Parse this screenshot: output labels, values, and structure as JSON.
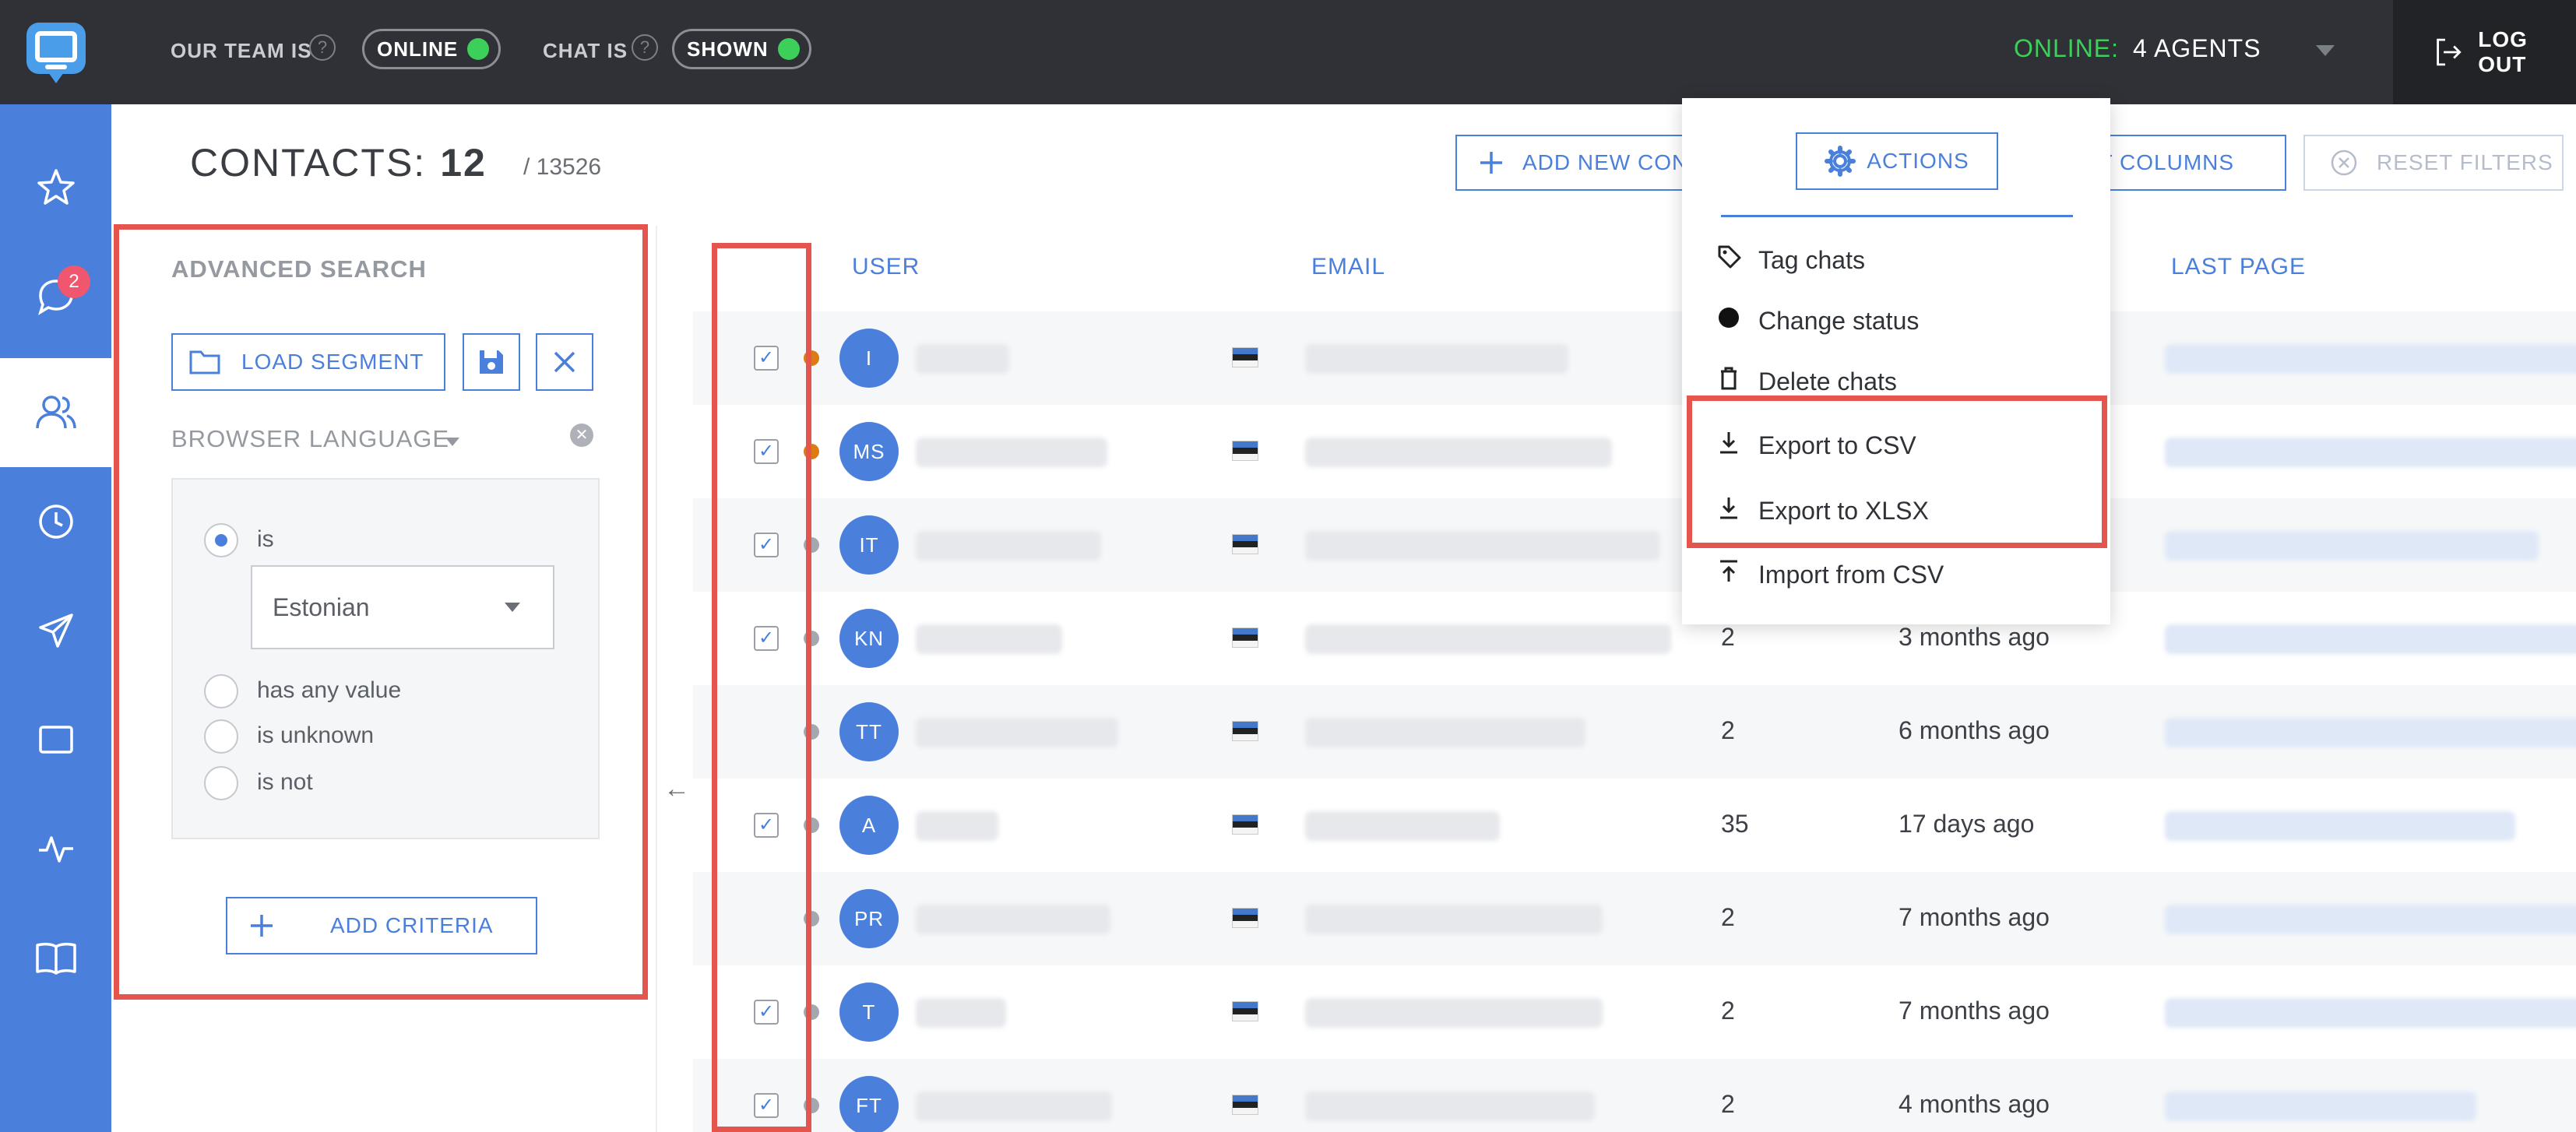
{
  "topbar": {
    "team_label": "OUR TEAM IS",
    "team_status": "ONLINE",
    "chat_label": "CHAT IS",
    "chat_status": "SHOWN",
    "online_key": "ONLINE:",
    "online_value": "4 AGENTS",
    "logout_label": "LOG OUT"
  },
  "nav": {
    "chat_badge": "2",
    "items": [
      "star-icon",
      "chat-icon",
      "users-icon",
      "clock-icon",
      "send-icon",
      "window-icon",
      "pulse-icon",
      "book-icon"
    ]
  },
  "header": {
    "title": "CONTACTS:",
    "count": "12",
    "total": "/ 13526",
    "add_new_label": "ADD NEW CONTACT",
    "edit_columns_label": "EDIT COLUMNS",
    "reset_filters_label": "RESET FILTERS"
  },
  "advanced_search": {
    "title": "ADVANCED SEARCH",
    "load_segment_label": "LOAD SEGMENT",
    "filter_label": "BROWSER LANGUAGE",
    "options": [
      "is",
      "has any value",
      "is unknown",
      "is not"
    ],
    "selected_option": "is",
    "selected_value": "Estonian",
    "add_criteria_label": "ADD CRITERIA"
  },
  "table": {
    "columns": [
      "USER",
      "EMAIL",
      "LAST PAGE"
    ],
    "rows": [
      {
        "initials": "I",
        "checked": true,
        "status": "orange",
        "chats": "",
        "last_seen": ""
      },
      {
        "initials": "MS",
        "checked": true,
        "status": "orange",
        "chats": "",
        "last_seen": ""
      },
      {
        "initials": "IT",
        "checked": true,
        "status": "grey",
        "chats": "",
        "last_seen": ""
      },
      {
        "initials": "KN",
        "checked": true,
        "status": "grey",
        "chats": "2",
        "last_seen": "3 months ago"
      },
      {
        "initials": "TT",
        "checked": false,
        "status": "grey",
        "chats": "2",
        "last_seen": "6 months ago"
      },
      {
        "initials": "A",
        "checked": true,
        "status": "grey",
        "chats": "35",
        "last_seen": "17 days ago"
      },
      {
        "initials": "PR",
        "checked": false,
        "status": "grey",
        "chats": "2",
        "last_seen": "7 months ago"
      },
      {
        "initials": "T",
        "checked": true,
        "status": "grey",
        "chats": "2",
        "last_seen": "7 months ago"
      },
      {
        "initials": "FT",
        "checked": true,
        "status": "grey",
        "chats": "2",
        "last_seen": "4 months ago"
      }
    ]
  },
  "actions_menu": {
    "button_label": "ACTIONS",
    "items": [
      "Tag chats",
      "Change status",
      "Delete chats",
      "Export to CSV",
      "Export to XLSX",
      "Import from CSV"
    ]
  },
  "colors": {
    "accent": "#4a80dc",
    "topbar": "#2f3136",
    "online": "#3ccf5a",
    "highlight": "#e5544d",
    "badge": "#f0566e"
  }
}
